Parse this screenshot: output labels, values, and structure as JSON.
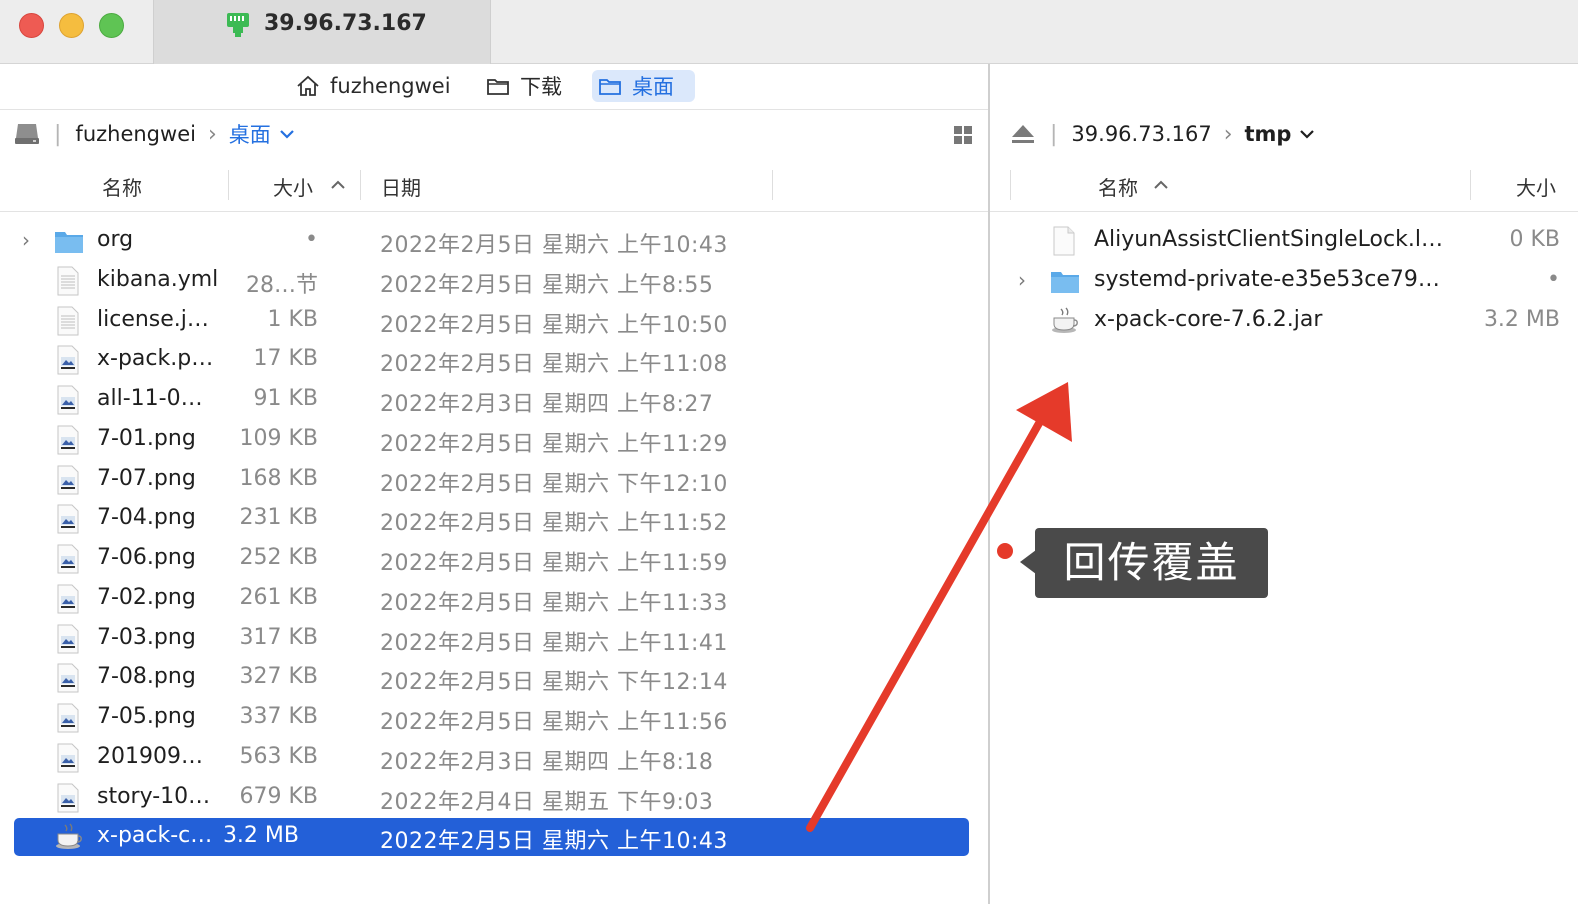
{
  "window": {
    "tab_title": "39.96.73.167"
  },
  "favorites": [
    {
      "label": "fuzhengwei",
      "icon": "home-icon",
      "active": false
    },
    {
      "label": "下载",
      "icon": "folder-icon",
      "active": false
    },
    {
      "label": "桌面",
      "icon": "folder-icon",
      "active": true
    }
  ],
  "left_pane": {
    "path_root": "fuzhengwei",
    "path_current": "桌面",
    "columns": {
      "name": "名称",
      "size": "大小",
      "date": "日期"
    },
    "rows": [
      {
        "name": "org",
        "size": "•",
        "date": "2022年2月5日 星期六 上午10:43",
        "type": "folder",
        "expandable": true
      },
      {
        "name": "kibana.yml",
        "size": "28…节",
        "date": "2022年2月5日 星期六 上午8:55",
        "type": "text"
      },
      {
        "name": "license.j…",
        "size": "1 KB",
        "date": "2022年2月5日 星期六 上午10:50",
        "type": "text"
      },
      {
        "name": "x-pack.p…",
        "size": "17 KB",
        "date": "2022年2月5日 星期六 上午11:08",
        "type": "image"
      },
      {
        "name": "all-11-0…",
        "size": "91 KB",
        "date": "2022年2月3日 星期四 上午8:27",
        "type": "image"
      },
      {
        "name": "7-01.png",
        "size": "109 KB",
        "date": "2022年2月5日 星期六 上午11:29",
        "type": "image"
      },
      {
        "name": "7-07.png",
        "size": "168 KB",
        "date": "2022年2月5日 星期六 下午12:10",
        "type": "image"
      },
      {
        "name": "7-04.png",
        "size": "231 KB",
        "date": "2022年2月5日 星期六 上午11:52",
        "type": "image"
      },
      {
        "name": "7-06.png",
        "size": "252 KB",
        "date": "2022年2月5日 星期六 上午11:59",
        "type": "image"
      },
      {
        "name": "7-02.png",
        "size": "261 KB",
        "date": "2022年2月5日 星期六 上午11:33",
        "type": "image"
      },
      {
        "name": "7-03.png",
        "size": "317 KB",
        "date": "2022年2月5日 星期六 上午11:41",
        "type": "image"
      },
      {
        "name": "7-08.png",
        "size": "327 KB",
        "date": "2022年2月5日 星期六 下午12:14",
        "type": "image"
      },
      {
        "name": "7-05.png",
        "size": "337 KB",
        "date": "2022年2月5日 星期六 上午11:56",
        "type": "image"
      },
      {
        "name": "201909…",
        "size": "563 KB",
        "date": "2022年2月3日 星期四 上午8:18",
        "type": "image"
      },
      {
        "name": "story-10…",
        "size": "679 KB",
        "date": "2022年2月4日 星期五 下午9:03",
        "type": "image"
      },
      {
        "name": "x-pack-c…",
        "size": "3.2 MB",
        "date": "2022年2月5日 星期六 上午10:43",
        "type": "jar",
        "selected": true
      }
    ]
  },
  "right_pane": {
    "path_root": "39.96.73.167",
    "path_current": "tmp",
    "columns": {
      "name": "名称",
      "size": "大小"
    },
    "rows": [
      {
        "name": "AliyunAssistClientSingleLock.l…",
        "size": "0 KB",
        "type": "blank"
      },
      {
        "name": "systemd-private-e35e53ce79…",
        "size": "•",
        "type": "folder",
        "expandable": true
      },
      {
        "name": "x-pack-core-7.6.2.jar",
        "size": "3.2 MB",
        "type": "jar"
      }
    ]
  },
  "annotation": {
    "label": "回传覆盖",
    "color": "#e53a2a"
  }
}
